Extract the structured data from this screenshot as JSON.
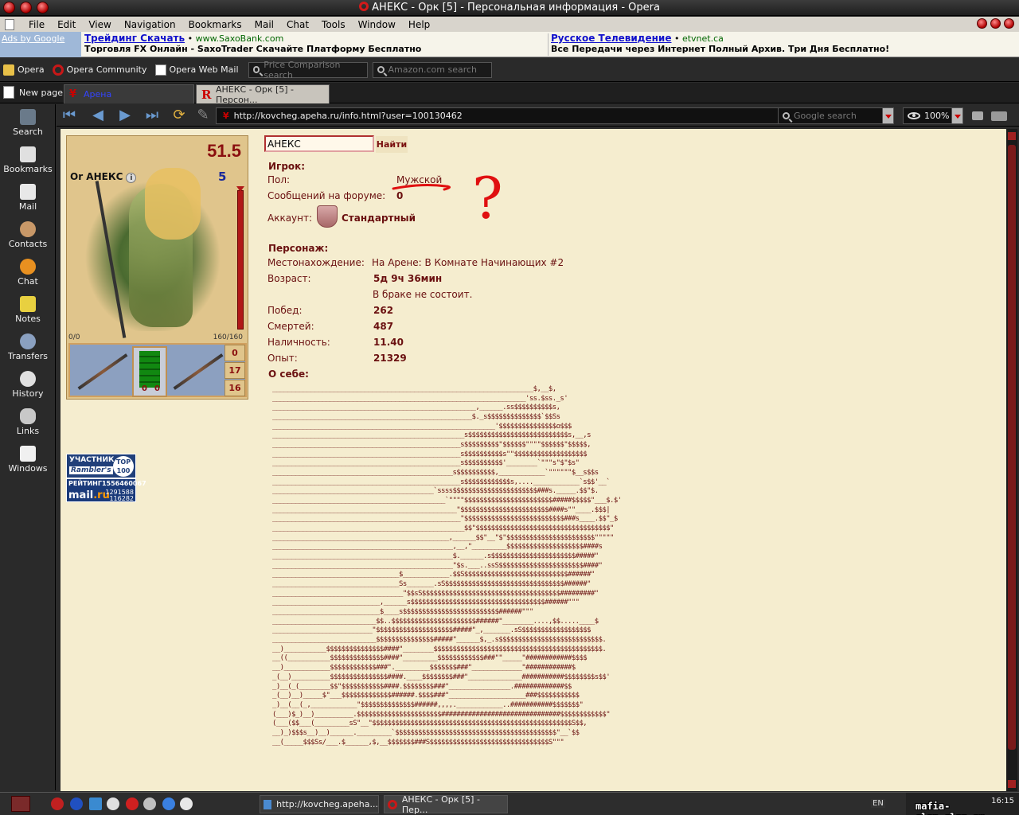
{
  "window": {
    "title": "АНЕКС - Орк [5] - Персональная информация - Opera"
  },
  "menu": [
    "File",
    "Edit",
    "View",
    "Navigation",
    "Bookmarks",
    "Mail",
    "Chat",
    "Tools",
    "Window",
    "Help"
  ],
  "ads": {
    "label": "Ads by Google",
    "ad1": {
      "link": "Трейдинг Скачать",
      "source": "www.SaxoBank.com",
      "desc": "Торговля FX Онлайн - SaxoTrader Скачайте Платформу Бесплатно"
    },
    "ad2": {
      "link": "Русское Телевидение",
      "source": "etvnet.ca",
      "desc": "Все Передачи через Интернет Полный Архив. Три Дня Бесплатно!"
    }
  },
  "personal_bar": {
    "opera": "Opera",
    "community": "Opera Community",
    "webmail": "Opera Web Mail",
    "price_search": "Price Comparison search",
    "amazon_search": "Amazon.com search"
  },
  "tabs": {
    "new_page": "New page",
    "tab1": "Арена",
    "tab2": "АНЕКС - Орк [5] - Персон..."
  },
  "panel": [
    "Search",
    "Bookmarks",
    "Mail",
    "Contacts",
    "Chat",
    "Notes",
    "Transfers",
    "History",
    "Links",
    "Windows"
  ],
  "nav": {
    "url": "http://kovcheg.apeha.ru/info.html?user=100130462",
    "search_placeholder": "Google search",
    "zoom": "100%"
  },
  "character": {
    "level_rating": "51.5",
    "name": "Or АНЕКС",
    "info_glyph": "i",
    "level": "5",
    "mana": "0/0",
    "hp": "160/160",
    "side_values": [
      "0",
      "17",
      "16"
    ],
    "doll_values": [
      "0",
      "0"
    ]
  },
  "counters": {
    "rambler_title": "УЧАСТНИК",
    "rambler_name": "Rambler's",
    "rambler_top": "TOP 100",
    "mailru_label": "РЕЙТИНГ",
    "mailru_counter": "1556460067",
    "mailru_brand": "mail",
    "mailru_tld": ".ru",
    "mailru_v1": "1291588",
    "mailru_v2": "116282"
  },
  "search": {
    "value": "АНЕКС",
    "button": "Найти"
  },
  "player": {
    "section": "Игрок:",
    "gender_label": "Пол:",
    "gender_value": "Мужской",
    "forum_label": "Сообщений на форуме:",
    "forum_value": "0",
    "account_label": "Аккаунт:",
    "account_value": "Стандартный"
  },
  "persona": {
    "section": "Персонаж:",
    "location_label": "Местонахождение:",
    "location_value": "На Арене: В Комнате Начинающих #2",
    "age_label": "Возраст:",
    "age_value": "5д 9ч 36мин",
    "marriage": "В браке не состоит.",
    "wins_label": "Побед:",
    "wins_value": "262",
    "deaths_label": "Смертей:",
    "deaths_value": "487",
    "cash_label": "Наличность:",
    "cash_value": "11.40",
    "exp_label": "Опыт:",
    "exp_value": "21329",
    "about_label": "О себе:"
  },
  "annotation": {
    "mark": "?"
  },
  "about_ascii": [
    "____________________________________________________________________$,__$,",
    "__________________________________________________________________'ss.$ss._s'",
    "_____________________________________________________,______.ss$$$$$$$$$$s,",
    "____________________________________________________$._s$$$$$$$$$$$$$$`$$Ss",
    "__________________________________________________________'$$$$$$$$$$$$$$$o$$$",
    "__________________________________________________s$$$$$$$$$$$$$$$$$$$$$$$$$$s,__,s",
    "_________________________________________________s$$$$$$$$$\"$$$$$$\"\"\"\"$$$$$$\"$$$$$,",
    "_________________________________________________s$$$$$$$$$$s\"\"$$$$$$$$$$$$$$$$$$$",
    "_________________________________________________s$$$$$$$$$$'________`\"\"\"s\"$\"$s\"",
    "_______________________________________________s$$$$$$$$$$,____________`\"\"\"\"\"\"$__s$$s",
    "_________________________________________________s$$$$$$$$$$$$s,....____________`s$$'__`",
    "__________________________________________`ssss$$$$$$$$$$$$$$$$$$$$$$###s._____.$$\"$.",
    "_____________________________________________`\"\"\"\"$$$$$$$$$$$$$$$$$$$$$$$#####$$$$$\"___$.$'",
    "________________________________________________\"$$$$$$$$$$$$$$$$$$$$$$$####s\"\"____.$$$|",
    "_________________________________________________\"$$$$$$$$$$$$$$$$$$$$$$$$$$###s____.$$\"_$",
    "__________________________________________________$$\"$$$$$$$$$$$$$$$$$$$$$$$$$$$$$$$$$$$\"",
    "______________________________________________,______$$\"__\"$\"$$$$$$$$$$$$$$$$$$$$$$$\"\"\"\"\"",
    "_______________________________________________,__,\"_________$$$$$$$$$$$$$$$$$$$$####s",
    "_______________________________________________$.______.s$$$$$$$$$$$$$$$$$$$$$$#####\"",
    "_______________________________________________\"$s.___..ssS$$$$$$$$$$$$$$$$$$$$$$####\"",
    "_________________________________$____________.$$S$$$$$$$$$$$$$$$$$$$$$$$$$$$######\"",
    "_________________________________Ss_______.sS$$$$$$$$$$$$$$$$$$$$$$$$$$$$$$$######\"",
    "__________________________________\"$$sS$$$$$$$$$$$$$$$$$$$$$$$$$$$$$$$$$$$$#########\"",
    "____________________________,______s$$$$$$$$$$$$$$$$$$$$$$$$$$$$$$$$$$$######\"\"\"",
    "____________________________$____s$$$$$$$$$$$$$$$$$$$$$$$$$######\"\"\"",
    "___________________________$$..$$$$$$$$$$$$$$$$$$$$$$######\"________....,$$.....____$",
    "__________________________\"$$$$$$$$$$$$$$$$$$$$#####\"_,_______.sS$$$$$$$$$$$$$$$$$$",
    "___________________________$$$$$$$$$$$$$$$#####\"______$,_.s$$$$$$$$$$$$$$$$$$$$$$$$$$$.",
    "__)___________$$$$$$$$$$$$$$$####\"________$$$$$$$$$$$$$$$$$$$$$$$$$$$$$$$$$$$$$$$$$$$$.",
    "__((___________$$$$$$$$$$$$$$####\"_________$$$$$$$$$$$$###\"\"_____\"############$$$$",
    "__)____________$$$$$$$$$$$$###\"._________$$$$$$$###\"_____________\"############$",
    "_(__)__________$$$$$$$$$$$$$$$####.____$$$$$$$$###\"______________###########$$$$$$$$s$$'",
    "_)__(_(________$$\"$$$$$$$$$$$####.$$$$$$$$###\"________________.#############$$",
    "_(__)__)_____$\"___$$$$$$$$$$$$$######.$$$$###\"____________________###$$$$$$$$$$$",
    "_)__(__(_,____________\"$$$$$$$$$$$$$$######,,,,.____________..###########$$$$$$$\"",
    "(___)$_)__)__________.$$$$$$$$$$$$$$$$$$$$$$###############################$$$$$$$$$$$$\"",
    "(___($$___(_________sS\"__\"$$$$$$$$$$$$$$$$$$$$$$$$$$$$$$$$$$$$$$$$$$$$$$$$$$$$S$$,",
    "__)_)$$$s__)__)______._________`$$$$$$$$$$$$$$$$$$$$$$$$$$$$$$$$$$$$$$$$$$\"__`$$",
    "__(_____$$$Ss/___.$______,$,__$$$$$$$###S$$$$$$$$$$$$$$$$$$$$$$$$$$$$$$$S\"\"\""
  ],
  "taskbar": {
    "task1": "http://kovcheg.apeha...",
    "task2": "АНЕКС - Орк [5] - Пер...",
    "lang": "EN",
    "time": "16:15"
  },
  "watermark": "mafia-clan.clan.su"
}
